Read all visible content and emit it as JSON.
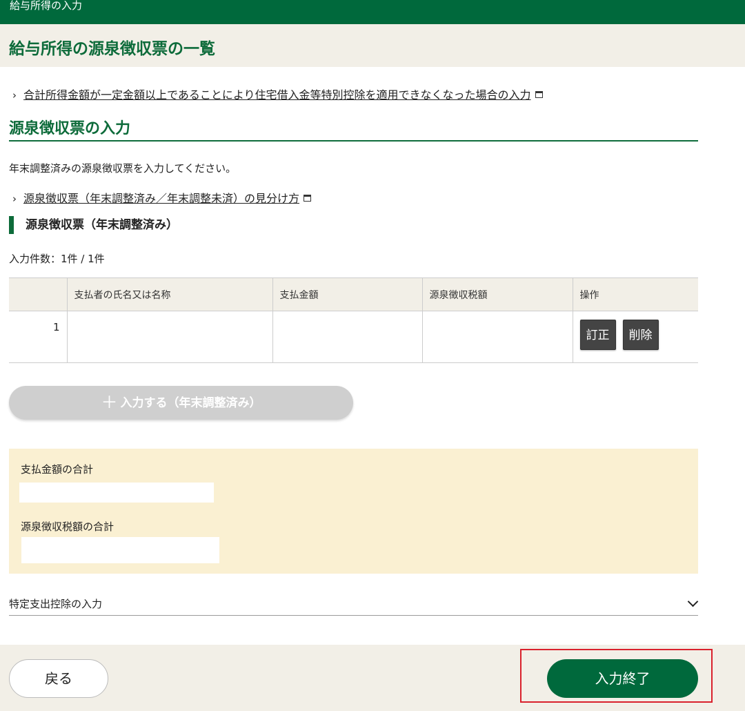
{
  "header": {
    "breadcrumb": "給与所得の入力",
    "page_title": "給与所得の源泉徴収票の一覧"
  },
  "links": {
    "housing_loan": "合計所得金額が一定金額以上であることにより住宅借入金等特別控除を適用できなくなった場合の入力",
    "distinguish": "源泉徴収票（年末調整済み／年末調整未済）の見分け方"
  },
  "section": {
    "title": "源泉徴収票の入力",
    "description": "年末調整済みの源泉徴収票を入力してください。",
    "subsection_title": "源泉徴収票（年末調整済み）",
    "count_text": "入力件数：1件 / 1件"
  },
  "table": {
    "columns": [
      "",
      "支払者の氏名又は名称",
      "支払金額",
      "源泉徴収税額",
      "操作"
    ],
    "rows": [
      {
        "index": "1",
        "payer": "",
        "amount": "",
        "tax": ""
      }
    ],
    "edit_label": "訂正",
    "delete_label": "削除"
  },
  "add_button": {
    "plus": "＋",
    "label": "入力する（年末調整済み）"
  },
  "totals": {
    "amount_label": "支払金額の合計",
    "amount_value": "",
    "tax_label": "源泉徴収税額の合計",
    "tax_value": ""
  },
  "accordion": {
    "label": "特定支出控除の入力"
  },
  "footer": {
    "back_label": "戻る",
    "finish_label": "入力終了"
  },
  "colors": {
    "brand_green": "#00693c",
    "highlight_red": "#d9202c"
  },
  "icons": [
    "chevron-right-icon",
    "external-window-icon",
    "plus-icon",
    "chevron-down-icon"
  ]
}
